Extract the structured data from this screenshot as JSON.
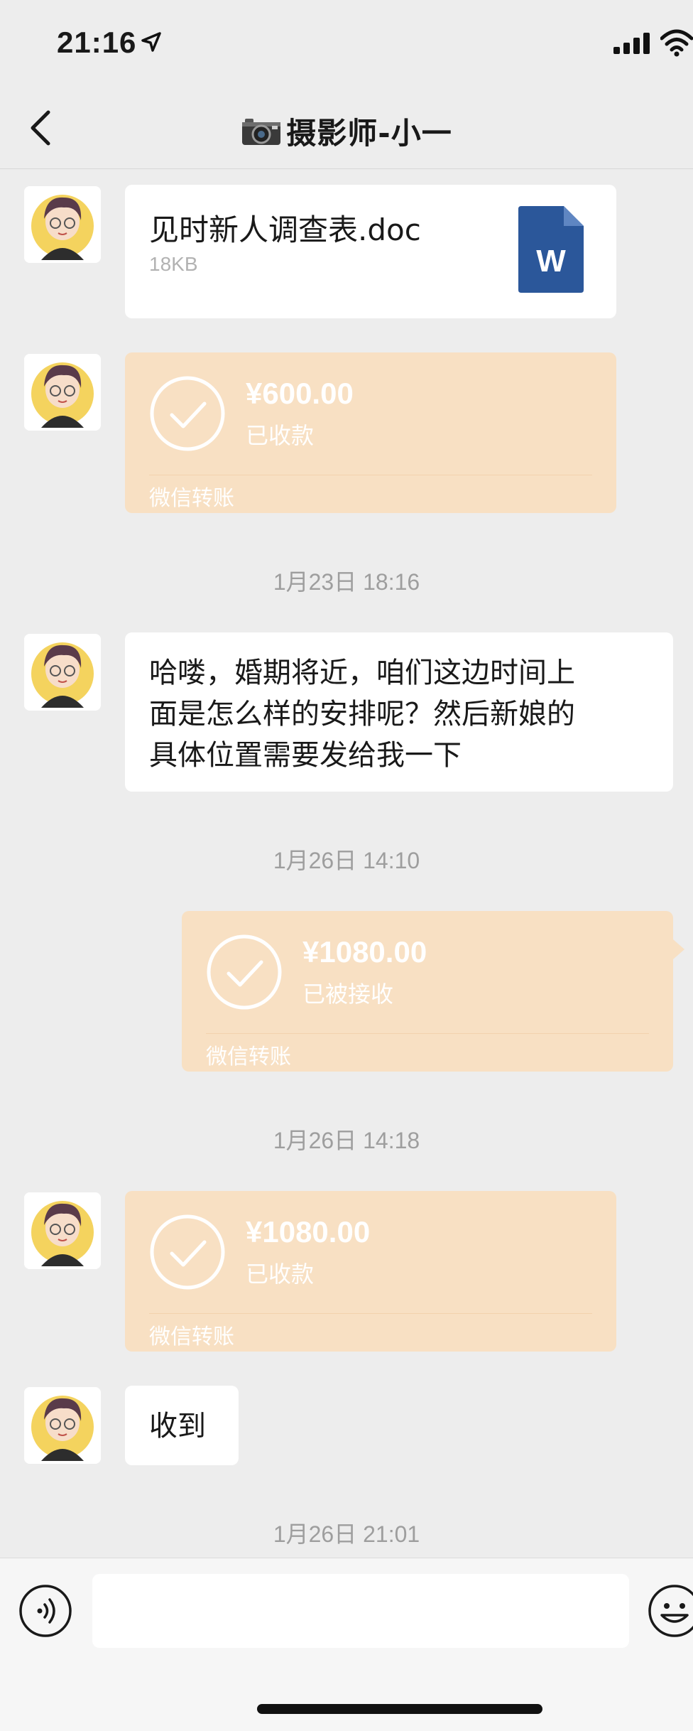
{
  "status_bar": {
    "time": "21:16",
    "location_icon": "location-arrow-icon",
    "signal_icon": "cellular-signal-icon",
    "wifi_icon": "wifi-icon"
  },
  "nav": {
    "back_icon": "chevron-left-icon",
    "title_icon": "camera-emoji-icon",
    "title": "摄影师-小一"
  },
  "messages": {
    "file": {
      "name": "见时新人调查表.doc",
      "size": "18KB",
      "icon": "word-document-icon",
      "icon_letter": "W"
    },
    "transfer1": {
      "amount": "¥600.00",
      "status": "已收款",
      "label": "微信转账"
    },
    "time1": "1月23日 18:16",
    "text1": {
      "lines": [
        "哈喽，婚期将近，咱们这边时间上",
        "面是怎么样的安排呢？然后新娘的",
        "具体位置需要发给我一下"
      ]
    },
    "time2": "1月26日 14:10",
    "transfer2": {
      "amount": "¥1080.00",
      "status": "已被接收",
      "label": "微信转账",
      "direction": "sent"
    },
    "time3": "1月26日 14:18",
    "transfer3": {
      "amount": "¥1080.00",
      "status": "已收款",
      "label": "微信转账"
    },
    "text2": "收到",
    "time4": "1月26日 21:01"
  },
  "input_bar": {
    "value": "",
    "voice_icon": "voice-icon",
    "emoji_icon": "emoji-icon"
  },
  "colors": {
    "background": "#ededed",
    "transfer_bubble": "#f8e0c3",
    "word_blue": "#2b579a",
    "timestamp": "#9e9e9e"
  }
}
